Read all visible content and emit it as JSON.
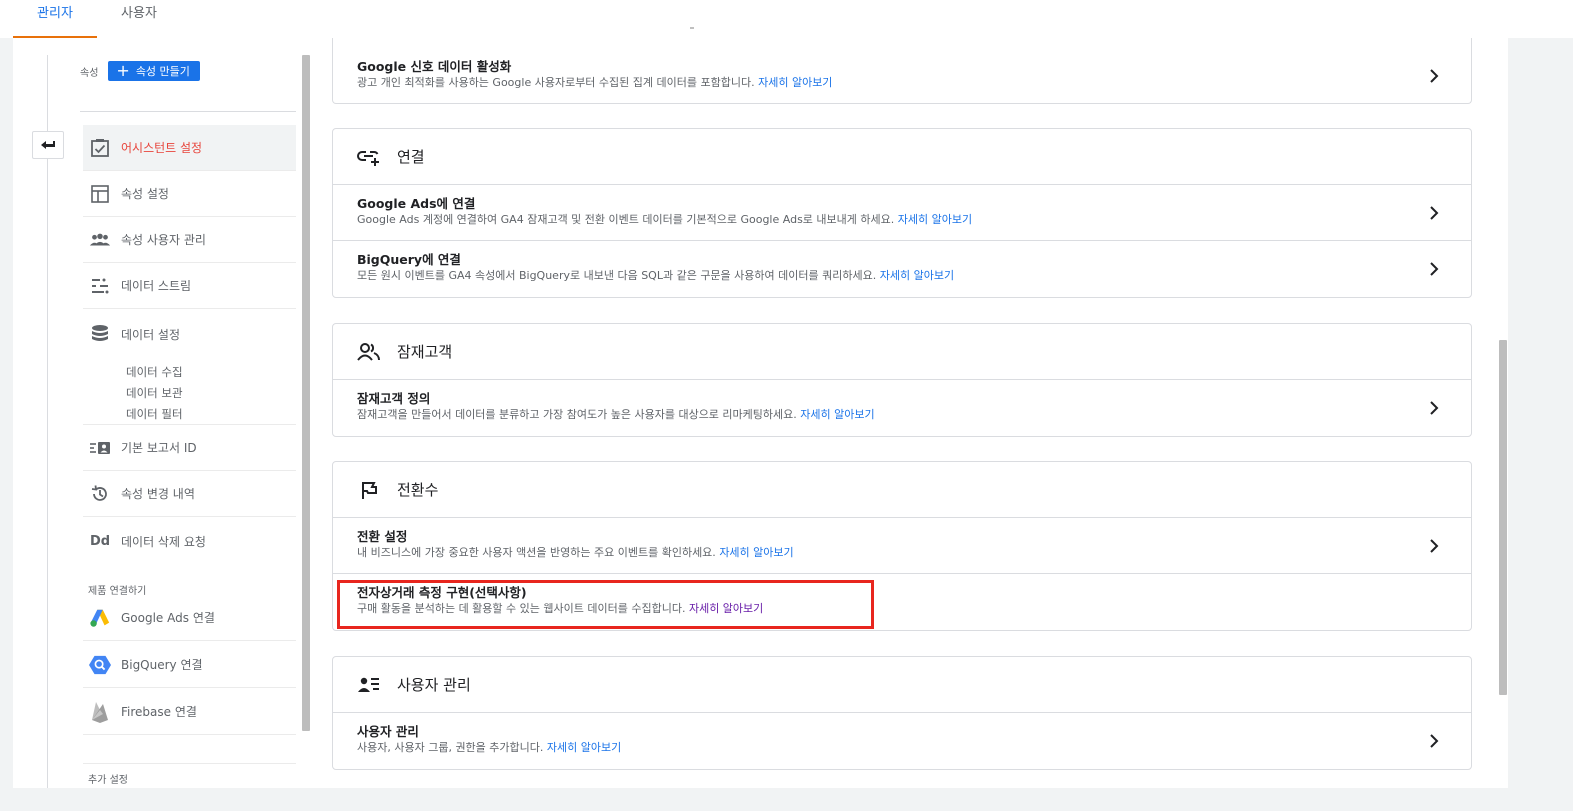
{
  "tabs": {
    "admin": "관리자",
    "user": "사용자"
  },
  "sidebar": {
    "property_label": "속성",
    "create_property": "속성 만들기",
    "items": [
      {
        "label": "어시스턴트 설정",
        "icon": "checklist-icon",
        "selected": true
      },
      {
        "label": "속성 설정",
        "icon": "layout-icon"
      },
      {
        "label": "속성 사용자 관리",
        "icon": "people-icon"
      },
      {
        "label": "데이터 스트림",
        "icon": "stream-icon"
      },
      {
        "label": "데이터 설정",
        "icon": "database-icon"
      }
    ],
    "sub_items": [
      "데이터 수집",
      "데이터 보관",
      "데이터 필터"
    ],
    "items2": [
      {
        "label": "기본 보고서 ID",
        "icon": "report-id-icon"
      },
      {
        "label": "속성 변경 내역",
        "icon": "history-icon"
      },
      {
        "label": "데이터 삭제 요청",
        "icon": "dd-icon"
      }
    ],
    "product_links_label": "제품 연결하기",
    "product_links": [
      {
        "label": "Google Ads 연결",
        "icon": "google-ads-icon"
      },
      {
        "label": "BigQuery 연결",
        "icon": "bigquery-icon"
      },
      {
        "label": "Firebase 연결",
        "icon": "firebase-icon"
      }
    ],
    "more_settings_label": "추가 설정"
  },
  "content": {
    "learn_more": "자세히 알아보기",
    "signals": {
      "title": "Google 신호 데이터 활성화",
      "desc": "광고 개인 최적화를 사용하는 Google 사용자로부터 수집된 집계 데이터를 포함합니다."
    },
    "linking": {
      "header": "연결",
      "rows": [
        {
          "title": "Google Ads에 연결",
          "desc": "Google Ads 계정에 연결하여 GA4 잠재고객 및 전환 이벤트 데이터를 기본적으로 Google Ads로 내보내게 하세요."
        },
        {
          "title": "BigQuery에 연결",
          "desc": "모든 원시 이벤트를 GA4 속성에서 BigQuery로 내보낸 다음 SQL과 같은 구문을 사용하여 데이터를 쿼리하세요."
        }
      ]
    },
    "audiences": {
      "header": "잠재고객",
      "rows": [
        {
          "title": "잠재고객 정의",
          "desc": "잠재고객을 만들어서 데이터를 분류하고 가장 참여도가 높은 사용자를 대상으로 리마케팅하세요."
        }
      ]
    },
    "conversions": {
      "header": "전환수",
      "rows": [
        {
          "title": "전환 설정",
          "desc": "내 비즈니스에 가장 중요한 사용자 액션을 반영하는 주요 이벤트를 확인하세요."
        },
        {
          "title": "전자상거래 측정 구현(선택사항)",
          "desc": "구매 활동을 분석하는 데 활용할 수 있는 웹사이트 데이터를 수집합니다."
        }
      ]
    },
    "user_management": {
      "header": "사용자 관리",
      "rows": [
        {
          "title": "사용자 관리",
          "desc": "사용자, 사용자 그룹, 권한을 추가합니다."
        }
      ]
    }
  },
  "colors": {
    "accent": "#1a73e8",
    "selected_text": "#e8453c",
    "highlight_border": "#e8261e",
    "tab_underline": "#e8710a"
  }
}
